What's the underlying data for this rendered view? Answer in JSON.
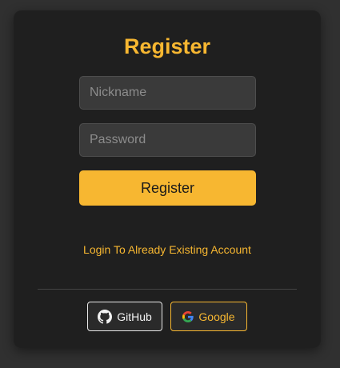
{
  "form": {
    "title": "Register",
    "nickname_placeholder": "Nickname",
    "nickname_value": "",
    "password_placeholder": "Password",
    "password_value": "",
    "submit_label": "Register",
    "login_link_label": "Login To Already Existing Account"
  },
  "social": {
    "github_label": "GitHub",
    "github_icon": "github-icon",
    "google_label": "Google",
    "google_icon": "google-icon"
  },
  "colors": {
    "accent": "#f7b731",
    "card_background": "#1f1f1f",
    "page_background": "#303030",
    "input_background": "#3a3a3a"
  }
}
